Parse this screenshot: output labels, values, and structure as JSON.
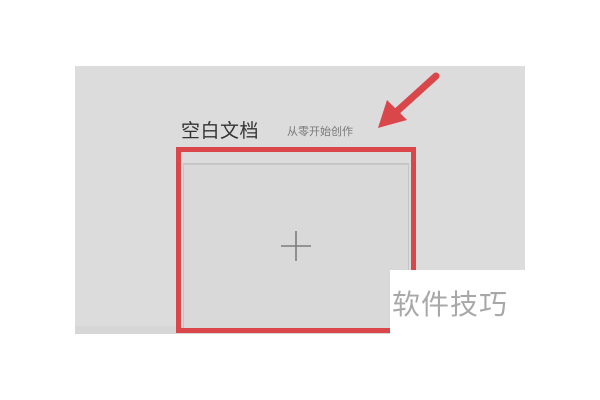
{
  "blank_document": {
    "title": "空白文档",
    "subtitle": "从零开始创作",
    "plus_icon": "plus-icon"
  },
  "annotation": {
    "highlight_color": "#d9474b",
    "arrow_icon": "arrow-icon"
  },
  "watermark": {
    "text": "软件技巧"
  }
}
